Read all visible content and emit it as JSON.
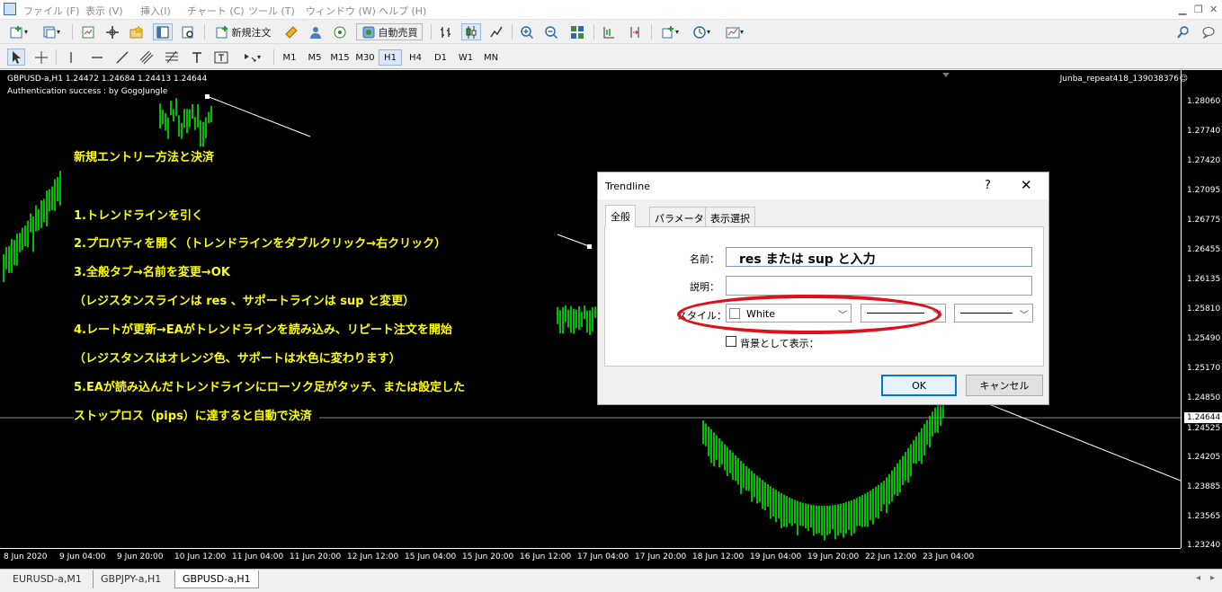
{
  "menu": {
    "items": [
      "ファイル (F)",
      "表示 (V)",
      "挿入(I)",
      "チャート (C)",
      "ツール (T)",
      "ウィンドウ (W)",
      "ヘルプ (H)"
    ]
  },
  "toolbar": {
    "new_order": "新規注文",
    "auto_trade": "自動売買",
    "timeframes": [
      "M1",
      "M5",
      "M15",
      "M30",
      "H1",
      "H4",
      "D1",
      "W1",
      "MN"
    ],
    "active_timeframe": "H1"
  },
  "chart": {
    "title": "GBPUSD-a,H1  1.24472 1.24684 1.24413 1.24644",
    "auth_message": "Authentication success : by GogoJungle",
    "ea_name": "Junba_repeat418_139038376",
    "smiley": "☺",
    "current_price": "1.24644",
    "price_labels": [
      "1.28060",
      "1.27740",
      "1.27420",
      "1.27095",
      "1.26775",
      "1.26455",
      "1.26135",
      "1.25810",
      "1.25490",
      "1.25170",
      "1.24850",
      "1.24525",
      "1.24205",
      "1.23885",
      "1.23565",
      "1.23240"
    ],
    "time_labels": [
      "8 Jun 2020",
      "9 Jun 04:00",
      "9 Jun 20:00",
      "10 Jun 12:00",
      "11 Jun 04:00",
      "11 Jun 20:00",
      "12 Jun 12:00",
      "15 Jun 04:00",
      "15 Jun 20:00",
      "16 Jun 12:00",
      "17 Jun 04:00",
      "17 Jun 20:00",
      "18 Jun 12:00",
      "19 Jun 04:00",
      "19 Jun 20:00",
      "22 Jun 12:00",
      "23 Jun 04:00"
    ],
    "candle_color": "#00ff00"
  },
  "annotations": [
    "新規エントリー方法と決済",
    "1.トレンドラインを引く",
    "2.プロパティを開く（トレンドラインをダブルクリック→右クリック）",
    "3.全般タブ→名前を変更→OK",
    "（レジスタンスラインは res 、サポートラインは sup と変更）",
    "4.レートが更新→EAがトレンドラインを読み込み、リピート注文を開始",
    "（レジスタンスはオレンジ色、サポートは水色に変わります）",
    "5.EAが読み込んだトレンドラインにローソク足がタッチ、または設定した",
    "ストップロス（pips）に達すると自動で決済"
  ],
  "dialog": {
    "title": "Trendline",
    "help": "?",
    "close": "✕",
    "tabs": [
      "全般",
      "パラメーター",
      "表示選択"
    ],
    "name_label": "名前：",
    "name_value": "res または sup と入力",
    "desc_label": "説明：",
    "style_label": "スタイル：",
    "color_value": "White",
    "background_label": "背景として表示：",
    "ok": "OK",
    "cancel": "キャンセル",
    "highlight_color": "#e0101b"
  },
  "chart_tabs": [
    "EURUSD-a,M1",
    "GBPJPY-a,H1",
    "GBPUSD-a,H1"
  ],
  "active_chart_tab": "GBPUSD-a,H1"
}
